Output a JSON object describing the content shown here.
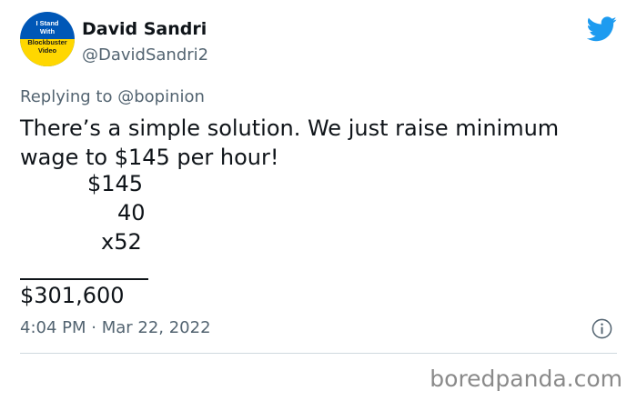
{
  "author": {
    "name": "David Sandri",
    "handle": "@DavidSandri2",
    "avatar_text": [
      "I Stand",
      "With",
      "Blockbuster",
      "Video"
    ],
    "avatar_colors": {
      "top": "#0057b7",
      "bottom": "#ffd700"
    }
  },
  "reply": {
    "prefix": "Replying to",
    "mention": "@bopinion"
  },
  "body": {
    "line1": "There’s a simple solution. We just raise minimum",
    "line2": "wage to $145 per hour!"
  },
  "calculation": {
    "line1": "$145",
    "line2": "40",
    "line3": "x52",
    "result": "$301,600"
  },
  "meta": {
    "timestamp": "4:04 PM · Mar 22, 2022"
  },
  "icons": {
    "platform": "twitter-bird-icon",
    "info": "info-icon"
  },
  "colors": {
    "twitter_blue": "#1d9bf0",
    "secondary_text": "#536471"
  },
  "watermark": "boredpanda.com"
}
